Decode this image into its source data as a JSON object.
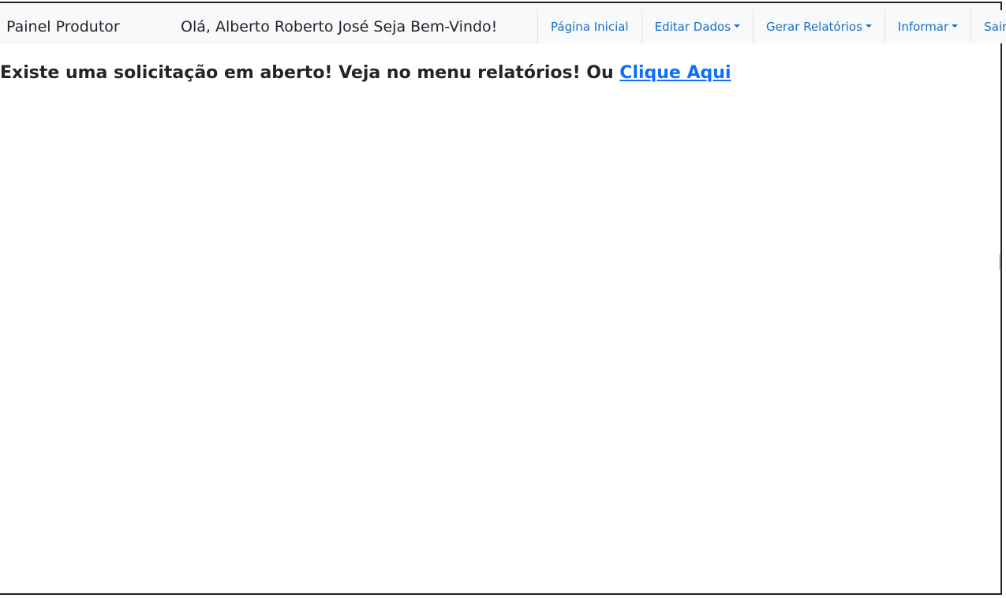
{
  "navbar": {
    "brand": "Painel Produtor",
    "welcome": "Olá, Alberto Roberto José Seja Bem-Vindo!",
    "menu": [
      {
        "label": "Página Inicial",
        "dropdown": false
      },
      {
        "label": "Editar Dados",
        "dropdown": true
      },
      {
        "label": "Gerar Relatórios",
        "dropdown": true
      },
      {
        "label": "Informar",
        "dropdown": true
      },
      {
        "label": "Sair",
        "dropdown": false
      }
    ]
  },
  "main": {
    "message": "Existe uma solicitação em aberto! Veja no menu relatórios! Ou ",
    "link_label": "Clique Aqui"
  },
  "colors": {
    "navbar_bg": "#f8f9fa",
    "link": "#0d6efd",
    "text": "#212529"
  }
}
